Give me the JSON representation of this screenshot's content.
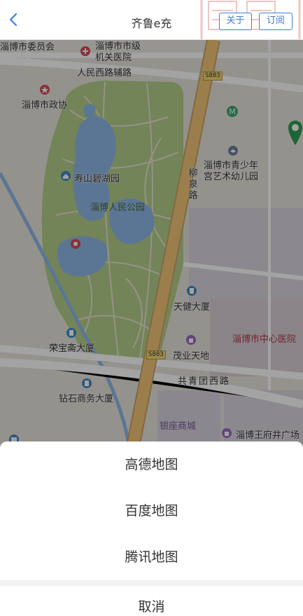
{
  "header": {
    "title": "齐鲁e充",
    "about_label": "关于",
    "subscribe_label": "订阅"
  },
  "map": {
    "labels": {
      "zibo_committee": "淄博市委员会",
      "municipal_hospital": "淄博市市级机关医院",
      "renmin_west_road": "人民西路辅路",
      "road_shield_top": "S803",
      "zibo_government": "淄博市政协",
      "shoushan_garden": "寿山碧湖园",
      "renmin_park": "淄博人民公园",
      "liuquan_road": "柳泉路",
      "youth_kindergarten": "淄博市青少年宫艺术幼儿园",
      "tianjian_building": "天健大厦",
      "central_hospital": "淄博市中心医院",
      "rongbaozhai": "荣宝斋大厦",
      "road_shield_bottom": "S803",
      "maoye": "茂业天地",
      "gongqingtuan_road": "共青团西路",
      "zuanshi_building": "钻石商务大厦",
      "yinzuo_mall": "银座商城",
      "wangfujing": "淄博王府井广场"
    }
  },
  "sheet": {
    "options": [
      "高德地图",
      "百度地图",
      "腾讯地图"
    ],
    "cancel": "取消"
  },
  "colors": {
    "accent": "#3d7fd6",
    "overlay": "rgba(0,0,0,0.36)",
    "park": "#b4cf8a",
    "water": "#8fb7e8",
    "main_road": "#f3c677"
  }
}
